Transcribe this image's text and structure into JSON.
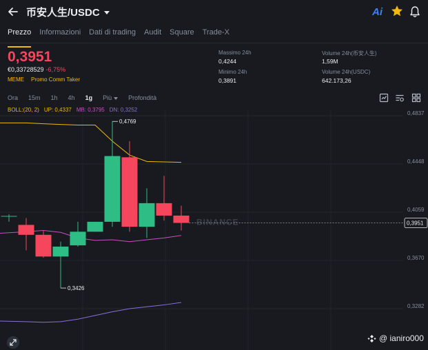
{
  "header": {
    "pair": "币安人生/USDC",
    "ai_label": "Ai",
    "colors": {
      "accent": "#f0b90b",
      "up": "#2ebd85",
      "down": "#f6465d",
      "ai": "#3b82f6"
    }
  },
  "tabs": [
    {
      "label": "Prezzo",
      "active": true
    },
    {
      "label": "Informazioni",
      "active": false
    },
    {
      "label": "Dati di trading",
      "active": false
    },
    {
      "label": "Audit",
      "active": false
    },
    {
      "label": "Square",
      "active": false
    },
    {
      "label": "Trade-X",
      "active": false
    }
  ],
  "ticker": {
    "price": "0,3951",
    "fiat": "€0,33728529",
    "change": "-6,75%",
    "tags": [
      "MEME",
      "Promo Comm Taker"
    ]
  },
  "stats": {
    "high_label": "Massimo 24h",
    "high": "0,4244",
    "low_label": "Minimo 24h",
    "low": "0,3891",
    "vol_base_label": "Volume 24h(币安人生)",
    "vol_base": "1,59M",
    "vol_quote_label": "Volume 24h(USDC)",
    "vol_quote": "642.173,26"
  },
  "intervals": [
    {
      "label": "Ora",
      "active": false
    },
    {
      "label": "15m",
      "active": false
    },
    {
      "label": "1h",
      "active": false
    },
    {
      "label": "4h",
      "active": false
    },
    {
      "label": "1g",
      "active": true
    },
    {
      "label": "Più",
      "active": false,
      "dropdown": true
    },
    {
      "label": "Profondità",
      "active": false
    }
  ],
  "indicator": {
    "name": "BOLL:(20, 2)",
    "up": "UP: 0,4337",
    "mb": "MB: 0,3795",
    "dn": "DN: 0,3252",
    "colors": {
      "name": "#f0b90b",
      "up": "#f0b90b",
      "mb": "#c850c0",
      "dn": "#8b6fd6"
    }
  },
  "chart_data": {
    "type": "candlestick",
    "y_ticks": [
      "0,4837",
      "0,4448",
      "0,4059",
      "0,3670",
      "0,3282"
    ],
    "ylim": [
      0.3282,
      0.4837
    ],
    "current_price": "0,3951",
    "current_price_value": 0.3951,
    "watermark": "BINANCE",
    "annotations": [
      {
        "text": "0,4769",
        "value": 0.4769,
        "candle": 6
      },
      {
        "text": "0,3426",
        "value": 0.3426,
        "candle": 3
      }
    ],
    "candles": [
      {
        "open": 0.4007,
        "close": 0.4007,
        "high": 0.402,
        "low": 0.396
      },
      {
        "open": 0.3935,
        "close": 0.3855,
        "high": 0.399,
        "low": 0.373
      },
      {
        "open": 0.3855,
        "close": 0.368,
        "high": 0.3885,
        "low": 0.367
      },
      {
        "open": 0.368,
        "close": 0.376,
        "high": 0.38,
        "low": 0.3426
      },
      {
        "open": 0.377,
        "close": 0.388,
        "high": 0.396,
        "low": 0.376
      },
      {
        "open": 0.388,
        "close": 0.396,
        "high": 0.396,
        "low": 0.388
      },
      {
        "open": 0.396,
        "close": 0.449,
        "high": 0.4769,
        "low": 0.392
      },
      {
        "open": 0.448,
        "close": 0.392,
        "high": 0.461,
        "low": 0.388
      },
      {
        "open": 0.392,
        "close": 0.411,
        "high": 0.423,
        "low": 0.383
      },
      {
        "open": 0.411,
        "close": 0.401,
        "high": 0.433,
        "low": 0.397
      },
      {
        "open": 0.401,
        "close": 0.3951,
        "high": 0.409,
        "low": 0.389
      }
    ],
    "boll_up": [
      0.4757,
      0.4757,
      0.475,
      0.4745,
      0.474,
      0.474,
      0.461,
      0.4498,
      0.4446,
      0.4443,
      0.4439
    ],
    "boll_mb": [
      0.3868,
      0.388,
      0.389,
      0.3875,
      0.383,
      0.381,
      0.3815,
      0.38,
      0.3815,
      0.383,
      0.385
    ],
    "boll_dn": [
      0.316,
      0.3155,
      0.315,
      0.3155,
      0.3175,
      0.3205,
      0.3235,
      0.326,
      0.3275,
      0.329,
      0.331
    ]
  },
  "footer": {
    "watermark": "@ ianiro000"
  }
}
